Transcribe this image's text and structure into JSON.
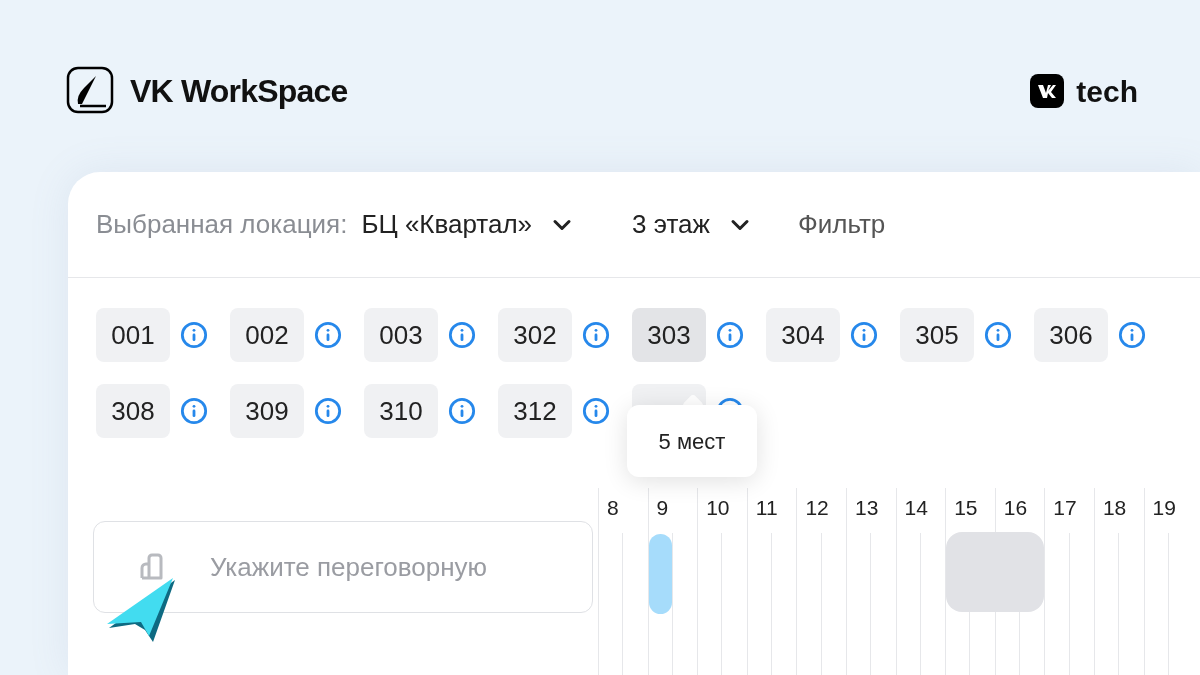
{
  "header": {
    "product": "VK WorkSpace",
    "partner": "tech"
  },
  "toolbar": {
    "location_label": "Выбранная локация:",
    "location": "БЦ «Квартал»",
    "floor": "3 этаж",
    "filter": "Фильтр"
  },
  "room_rows": [
    {
      "rooms": [
        {
          "label": "001",
          "selected": false
        },
        {
          "label": "002",
          "selected": false
        },
        {
          "label": "003",
          "selected": false
        },
        {
          "label": "302",
          "selected": false
        },
        {
          "label": "303",
          "selected": true
        },
        {
          "label": "304",
          "selected": false
        },
        {
          "label": "305",
          "selected": false
        },
        {
          "label": "306",
          "selected": false
        }
      ]
    },
    {
      "rooms": [
        {
          "label": "308",
          "selected": false
        },
        {
          "label": "309",
          "selected": false
        },
        {
          "label": "310",
          "selected": false
        },
        {
          "label": "312",
          "selected": false
        },
        {
          "selected": false,
          "tooltip": "5 мест"
        }
      ]
    }
  ],
  "room_field": {
    "placeholder": "Укажите переговорную"
  },
  "timeline": {
    "hours": [
      {
        "label": "8",
        "slots": [
          {
            "kind": "free"
          },
          {
            "kind": "free"
          }
        ]
      },
      {
        "label": "9",
        "slots": [
          {
            "kind": "selected"
          },
          {
            "kind": "free"
          }
        ]
      },
      {
        "label": "10",
        "slots": [
          {
            "kind": "free"
          },
          {
            "kind": "free"
          }
        ]
      },
      {
        "label": "11",
        "slots": [
          {
            "kind": "free"
          },
          {
            "kind": "free"
          }
        ]
      },
      {
        "label": "12",
        "slots": [
          {
            "kind": "free"
          },
          {
            "kind": "free"
          }
        ]
      },
      {
        "label": "13",
        "slots": [
          {
            "kind": "free"
          },
          {
            "kind": "free"
          }
        ]
      },
      {
        "label": "14",
        "slots": [
          {
            "kind": "free"
          },
          {
            "kind": "free"
          }
        ]
      },
      {
        "label": "15",
        "slots": [
          {
            "kind": "busy"
          },
          {
            "kind": "busy"
          }
        ]
      },
      {
        "label": "16",
        "slots": [
          {
            "kind": "busy"
          },
          {
            "kind": "busy"
          }
        ]
      },
      {
        "label": "17",
        "slots": [
          {
            "kind": "free"
          },
          {
            "kind": "free"
          }
        ]
      },
      {
        "label": "18",
        "slots": [
          {
            "kind": "free"
          },
          {
            "kind": "free"
          }
        ]
      },
      {
        "label": "19",
        "slots": [
          {
            "kind": "free"
          },
          {
            "kind": "free"
          }
        ]
      }
    ]
  }
}
